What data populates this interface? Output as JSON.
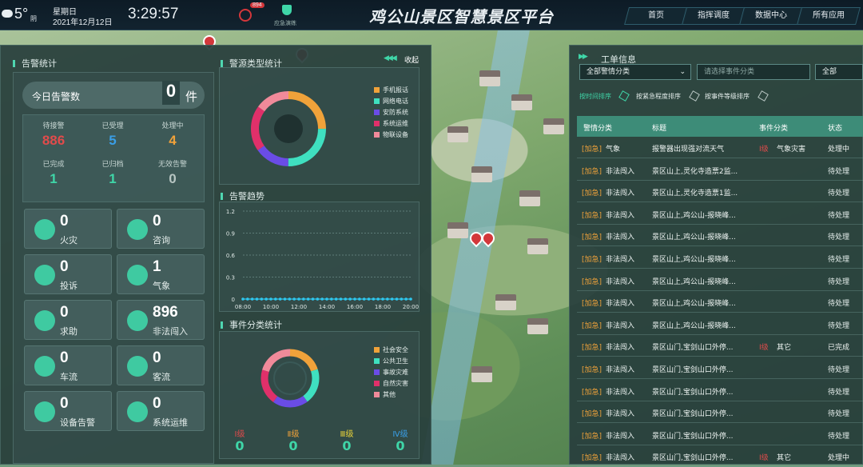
{
  "header": {
    "temperature": "5°",
    "weather": "阴",
    "weekday": "星期日",
    "date": "2021年12月12日",
    "time": "3:29:57",
    "alarm_badge": "894",
    "emergency_label": "应急演练",
    "title": "鸡公山景区智慧景区平台",
    "nav": [
      "首页",
      "指挥调度",
      "数据中心",
      "所有应用"
    ]
  },
  "alarm_stats": {
    "title": "告警统计",
    "today_label": "今日告警数",
    "today_value": "0",
    "today_unit": "件",
    "stats": [
      {
        "label": "待接警",
        "value": "886",
        "color": "#e14b4b"
      },
      {
        "label": "已受理",
        "value": "5",
        "color": "#3a9ee6"
      },
      {
        "label": "处理中",
        "value": "4",
        "color": "#f0a23a"
      },
      {
        "label": "已完成",
        "value": "1",
        "color": "#3fd6a8"
      },
      {
        "label": "已归档",
        "value": "1",
        "color": "#3fd6a8"
      },
      {
        "label": "无效告警",
        "value": "0",
        "color": "#b8c6c3"
      }
    ],
    "cards": [
      {
        "value": "0",
        "label": "火灾",
        "icon": "fire-icon"
      },
      {
        "value": "0",
        "label": "咨询",
        "icon": "chat-icon"
      },
      {
        "value": "0",
        "label": "投诉",
        "icon": "complaint-icon"
      },
      {
        "value": "1",
        "label": "气象",
        "icon": "cloud-icon"
      },
      {
        "value": "0",
        "label": "求助",
        "icon": "sos-icon"
      },
      {
        "value": "896",
        "label": "非法闯入",
        "icon": "intrusion-icon"
      },
      {
        "value": "0",
        "label": "车流",
        "icon": "car-icon"
      },
      {
        "value": "0",
        "label": "客流",
        "icon": "people-icon"
      },
      {
        "value": "0",
        "label": "设备告警",
        "icon": "device-icon"
      },
      {
        "value": "0",
        "label": "系统运维",
        "icon": "system-icon"
      }
    ]
  },
  "source_stats": {
    "title": "警源类型统计",
    "collapse_label": "收起",
    "legend": [
      {
        "label": "手机报话",
        "color": "#f0a23a"
      },
      {
        "label": "网络电话",
        "color": "#3fe0c0"
      },
      {
        "label": "安防系统",
        "color": "#6a4ce6"
      },
      {
        "label": "系统运维",
        "color": "#e0306a"
      },
      {
        "label": "物联设备",
        "color": "#f08a9a"
      }
    ]
  },
  "trend": {
    "title": "告警趋势",
    "chart_data": {
      "type": "line",
      "x": [
        "08:00",
        "10:00",
        "12:00",
        "14:00",
        "16:00",
        "18:00",
        "20:00"
      ],
      "yticks": [
        "0",
        "0.3",
        "0.6",
        "0.9",
        "1.2"
      ],
      "ylim": [
        0,
        1.2
      ],
      "series": [
        {
          "values": [
            0,
            0,
            0,
            0,
            0,
            0,
            0,
            0,
            0,
            0,
            0,
            0,
            0,
            0,
            0,
            0,
            0,
            0,
            0,
            0,
            0,
            0,
            0,
            0,
            0,
            0,
            0,
            0,
            0,
            0,
            0,
            0,
            0,
            0,
            0,
            0,
            0
          ]
        }
      ],
      "color": "#2ec8f0"
    }
  },
  "category_stats": {
    "title": "事件分类统计",
    "legend": [
      {
        "label": "社会安全",
        "color": "#f0a23a"
      },
      {
        "label": "公共卫生",
        "color": "#3fe0c0"
      },
      {
        "label": "事故灾难",
        "color": "#6a4ce6"
      },
      {
        "label": "自然灾害",
        "color": "#e0306a"
      },
      {
        "label": "其他",
        "color": "#f08a9a"
      }
    ],
    "levels": [
      {
        "label": "Ⅰ级",
        "value": "0",
        "color": "#e14b4b"
      },
      {
        "label": "Ⅱ级",
        "value": "0",
        "color": "#f0a23a"
      },
      {
        "label": "Ⅲ级",
        "value": "0",
        "color": "#e8d23a"
      },
      {
        "label": "Ⅳ级",
        "value": "0",
        "color": "#3a9ee6"
      }
    ]
  },
  "work_orders": {
    "title": "工单信息",
    "filter_select": "全部警情分类",
    "filter_placeholder": "请选择事件分类",
    "filter_all": "全部",
    "sort": [
      "按时间排序",
      "按紧急程度排序",
      "按事件等级排序"
    ],
    "columns": [
      "警情分类",
      "标题",
      "事件分类",
      "状态"
    ],
    "rows": [
      {
        "tag": "[加急]",
        "type": "气象",
        "title": "报警器出现强对流天气",
        "level": "Ⅰ级",
        "cat": "气象灾害",
        "status": "处理中"
      },
      {
        "tag": "[加急]",
        "type": "非法闯入",
        "title": "景区山上,灵化寺造票2监...",
        "level": "",
        "cat": "",
        "status": "待处理"
      },
      {
        "tag": "[加急]",
        "type": "非法闯入",
        "title": "景区山上,灵化寺造票1监...",
        "level": "",
        "cat": "",
        "status": "待处理"
      },
      {
        "tag": "[加急]",
        "type": "非法闯入",
        "title": "景区山上,鸡公山-报晓峰...",
        "level": "",
        "cat": "",
        "status": "待处理"
      },
      {
        "tag": "[加急]",
        "type": "非法闯入",
        "title": "景区山上,鸡公山-报晓峰...",
        "level": "",
        "cat": "",
        "status": "待处理"
      },
      {
        "tag": "[加急]",
        "type": "非法闯入",
        "title": "景区山上,鸡公山-报晓峰...",
        "level": "",
        "cat": "",
        "status": "待处理"
      },
      {
        "tag": "[加急]",
        "type": "非法闯入",
        "title": "景区山上,鸡公山-报晓峰...",
        "level": "",
        "cat": "",
        "status": "待处理"
      },
      {
        "tag": "[加急]",
        "type": "非法闯入",
        "title": "景区山上,鸡公山-报晓峰...",
        "level": "",
        "cat": "",
        "status": "待处理"
      },
      {
        "tag": "[加急]",
        "type": "非法闯入",
        "title": "景区山上,鸡公山-报晓峰...",
        "level": "",
        "cat": "",
        "status": "待处理"
      },
      {
        "tag": "[加急]",
        "type": "非法闯入",
        "title": "景区山门,宝剑山口外停...",
        "level": "Ⅰ级",
        "cat": "其它",
        "status": "已完成"
      },
      {
        "tag": "[加急]",
        "type": "非法闯入",
        "title": "景区山门,宝剑山口外停...",
        "level": "",
        "cat": "",
        "status": "待处理"
      },
      {
        "tag": "[加急]",
        "type": "非法闯入",
        "title": "景区山门,宝剑山口外停...",
        "level": "",
        "cat": "",
        "status": "待处理"
      },
      {
        "tag": "[加急]",
        "type": "非法闯入",
        "title": "景区山门,宝剑山口外停...",
        "level": "",
        "cat": "",
        "status": "待处理"
      },
      {
        "tag": "[加急]",
        "type": "非法闯入",
        "title": "景区山门,宝剑山口外停...",
        "level": "",
        "cat": "",
        "status": "待处理"
      },
      {
        "tag": "[加急]",
        "type": "非法闯入",
        "title": "景区山门,宝剑山口外停...",
        "level": "Ⅰ级",
        "cat": "其它",
        "status": "处理中"
      }
    ]
  }
}
